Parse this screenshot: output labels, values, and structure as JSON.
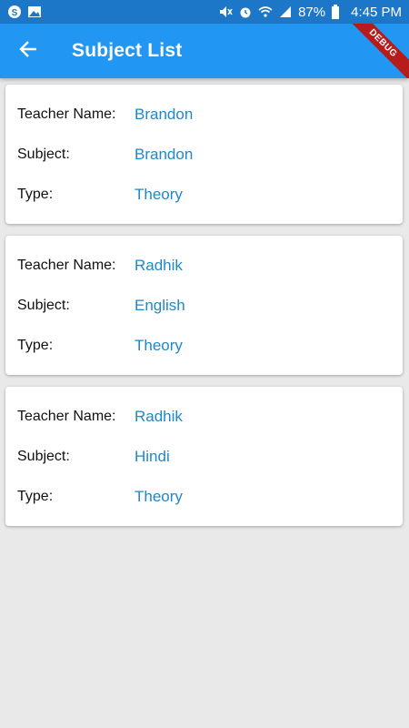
{
  "status_bar": {
    "battery": "87%",
    "time": "4:45 PM",
    "left_icons": [
      "skype-icon",
      "image-icon"
    ],
    "right_icons": [
      "mute-icon",
      "alarm-icon",
      "wifi-icon",
      "signal-icon",
      "battery-icon"
    ]
  },
  "app_bar": {
    "title": "Subject List",
    "back_icon": "arrow-left-icon",
    "debug_label": "DEBUG",
    "color": "#2196f3"
  },
  "cards": [
    {
      "teacher_label": "Teacher Name:",
      "teacher": "Brandon",
      "subject_label": "Subject:",
      "subject": "Brandon",
      "type_label": "Type:",
      "type": "Theory"
    },
    {
      "teacher_label": "Teacher Name:",
      "teacher": "Radhik",
      "subject_label": "Subject:",
      "subject": "English",
      "type_label": "Type:",
      "type": "Theory"
    },
    {
      "teacher_label": "Teacher Name:",
      "teacher": "Radhik",
      "subject_label": "Subject:",
      "subject": "Hindi",
      "type_label": "Type:",
      "type": "Theory"
    }
  ],
  "colors": {
    "value_text": "#1e88c8",
    "background": "#e9e9e9",
    "debug_banner": "#b71c1c"
  }
}
